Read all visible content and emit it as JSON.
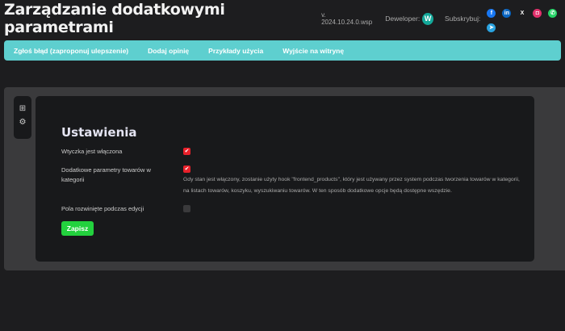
{
  "header": {
    "title": "Zarządzanie dodatkowymi parametrami",
    "version": "v. 2024.10.24.0.wsp",
    "developer_label": "Deweloper:",
    "subscribe_label": "Subskrybuj:",
    "social": [
      {
        "icon": "facebook-icon",
        "glyph": "f",
        "color": "#1877f2"
      },
      {
        "icon": "linkedin-icon",
        "glyph": "in",
        "color": "#0a66c2"
      },
      {
        "icon": "x-icon",
        "glyph": "X",
        "color": "transparent"
      },
      {
        "icon": "instagram-icon",
        "glyph": "◘",
        "color": "#e1306c"
      },
      {
        "icon": "whatsapp-icon",
        "glyph": "✆",
        "color": "#25d366"
      },
      {
        "icon": "telegram-icon",
        "glyph": "➤",
        "color": "#2aa3e0"
      }
    ]
  },
  "nav": [
    "Zgłoś błąd (zaproponuj ulepszenie)",
    "Dodaj opinię",
    "Przykłady użycia",
    "Wyjście na witrynę"
  ],
  "settings": {
    "title": "Ustawienia",
    "plugin_enabled": {
      "label": "Wtyczka jest włączona",
      "checked": true
    },
    "category_params": {
      "label": "Dodatkowe parametry towarów w kategorii",
      "checked": true,
      "help": "Gdy stan jest włączony, zostanie użyty hook \"frontend_products\", który jest używany przez system podczas tworzenia towarów w kategorii, na listach towarów, koszyku, wyszukiwaniu towarów. W ten sposób dodatkowe opcje będą dostępne wszędzie."
    },
    "expanded_fields": {
      "label": "Pola rozwinięte podczas edycji",
      "checked": false
    },
    "save_label": "Zapisz"
  },
  "colors": {
    "accent": "#5ecfcf",
    "checkbox": "#e8202a",
    "save": "#23d13e"
  }
}
